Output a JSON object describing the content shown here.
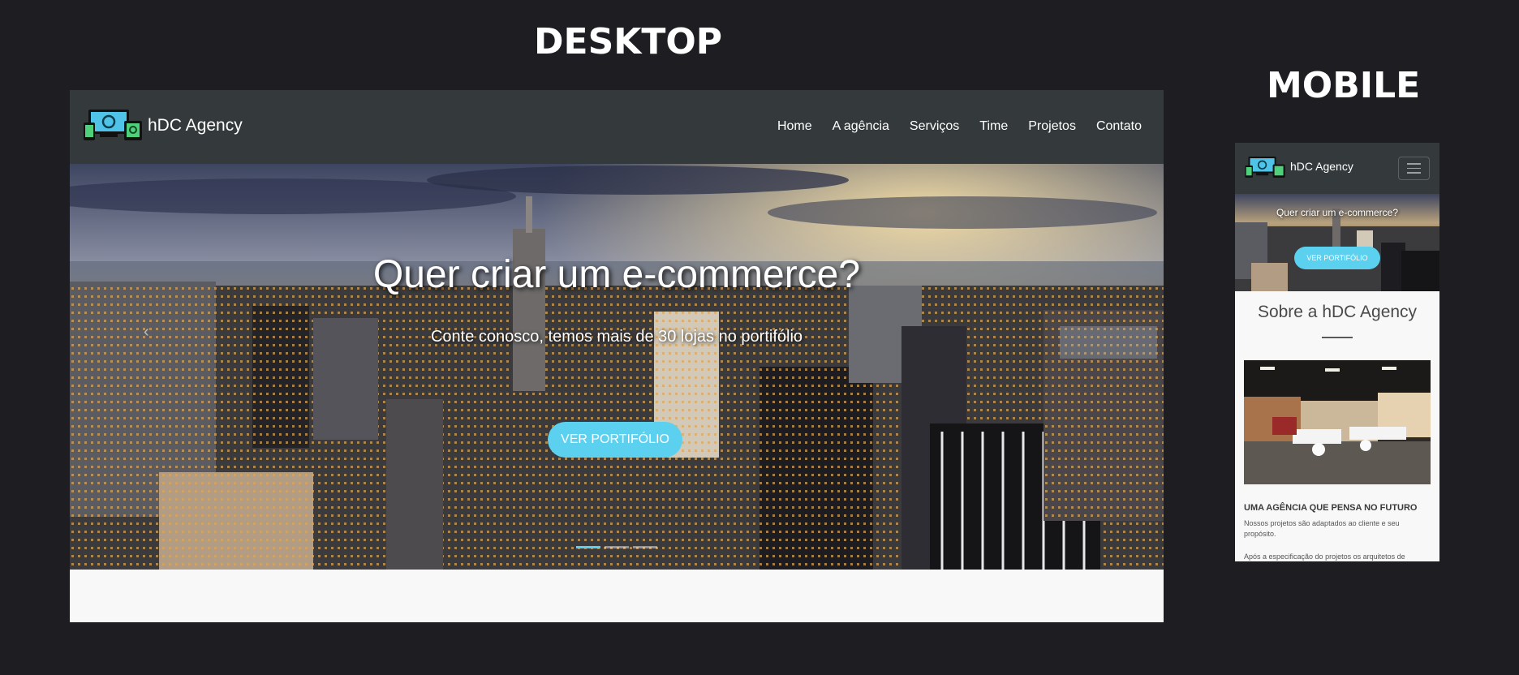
{
  "labels": {
    "desktop": "DESKTOP",
    "mobile": "MOBILE"
  },
  "desktop": {
    "brand": "hDC Agency",
    "nav": [
      "Home",
      "A agência",
      "Serviços",
      "Time",
      "Projetos",
      "Contato"
    ],
    "hero": {
      "title": "Quer criar um e-commerce?",
      "subtitle": "Conte conosco, temos mais de 30 lojas no portifólio",
      "button": "VER PORTIFÓLIO",
      "active_slide": 1,
      "slide_count": 3
    }
  },
  "mobile": {
    "brand": "hDC Agency",
    "hero": {
      "title": "Quer criar um e-commerce?",
      "button": "VER PORTIFÓLIO"
    },
    "about": {
      "title": "Sobre a hDC Agency",
      "heading": "UMA AGÊNCIA QUE PENSA NO FUTURO",
      "paragraph1": "Nossos projetos são adaptados ao cliente e seu propósito.",
      "paragraph2": "Após a especificação do projetos os arquitetos de"
    }
  },
  "colors": {
    "page_bg": "#1e1e22",
    "navbar": "#343a3c",
    "accent": "#5bd0ef",
    "content_bg": "#f8f8f8"
  },
  "icons": [
    "devices-logo-icon",
    "hamburger-menu-icon",
    "chevron-left-icon"
  ]
}
